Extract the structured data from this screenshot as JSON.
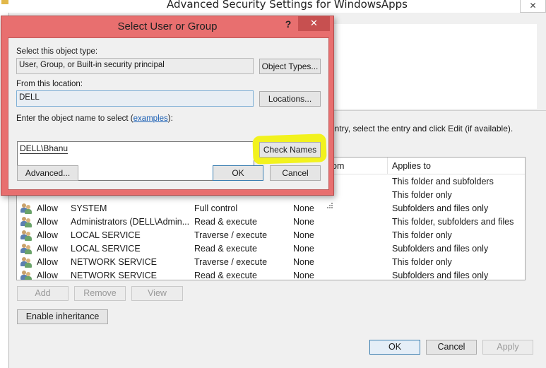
{
  "parent_window": {
    "title": "Advanced Security Settings for WindowsApps",
    "close_glyph": "✕",
    "instruction": "entry, select the entry and click Edit (if available).",
    "columns": [
      "om",
      "Applies to"
    ],
    "rows": [
      {
        "access": "",
        "principal": "",
        "permission": "",
        "inherited": "",
        "applies_to": "This folder and subfolders"
      },
      {
        "access": "",
        "principal": "",
        "permission": "",
        "inherited": "",
        "applies_to": "This folder only"
      },
      {
        "access": "Allow",
        "principal": "SYSTEM",
        "permission": "Full control",
        "inherited": "None",
        "applies_to": "Subfolders and files only"
      },
      {
        "access": "Allow",
        "principal": "Administrators (DELL\\Admin...",
        "permission": "Read & execute",
        "inherited": "None",
        "applies_to": "This folder, subfolders and files"
      },
      {
        "access": "Allow",
        "principal": "LOCAL SERVICE",
        "permission": "Traverse / execute",
        "inherited": "None",
        "applies_to": "This folder only"
      },
      {
        "access": "Allow",
        "principal": "LOCAL SERVICE",
        "permission": "Read & execute",
        "inherited": "None",
        "applies_to": "Subfolders and files only"
      },
      {
        "access": "Allow",
        "principal": "NETWORK SERVICE",
        "permission": "Traverse / execute",
        "inherited": "None",
        "applies_to": "This folder only"
      },
      {
        "access": "Allow",
        "principal": "NETWORK SERVICE",
        "permission": "Read & execute",
        "inherited": "None",
        "applies_to": "Subfolders and files only"
      }
    ],
    "buttons": {
      "add": "Add",
      "remove": "Remove",
      "view": "View",
      "enable_inheritance": "Enable inheritance",
      "ok": "OK",
      "cancel": "Cancel",
      "apply": "Apply"
    }
  },
  "dialog": {
    "title": "Select User or Group",
    "help_glyph": "?",
    "close_glyph": "✕",
    "object_type_label": "Select this object type:",
    "object_type_value": "User, Group, or Built-in security principal",
    "object_types_button": "Object Types...",
    "location_label": "From this location:",
    "location_value": "DELL",
    "locations_button": "Locations...",
    "names_label_prefix": "Enter the object name to select (",
    "names_label_link": "examples",
    "names_label_suffix": "):",
    "names_value": "DELL\\Bhanu",
    "check_names_button": "Check Names",
    "advanced_button": "Advanced...",
    "ok_button": "OK",
    "cancel_button": "Cancel"
  },
  "colors": {
    "dialog_frame": "#e86f6f",
    "close_button": "#c75050",
    "highlight": "#f2f21e",
    "link": "#1a5fb4"
  }
}
